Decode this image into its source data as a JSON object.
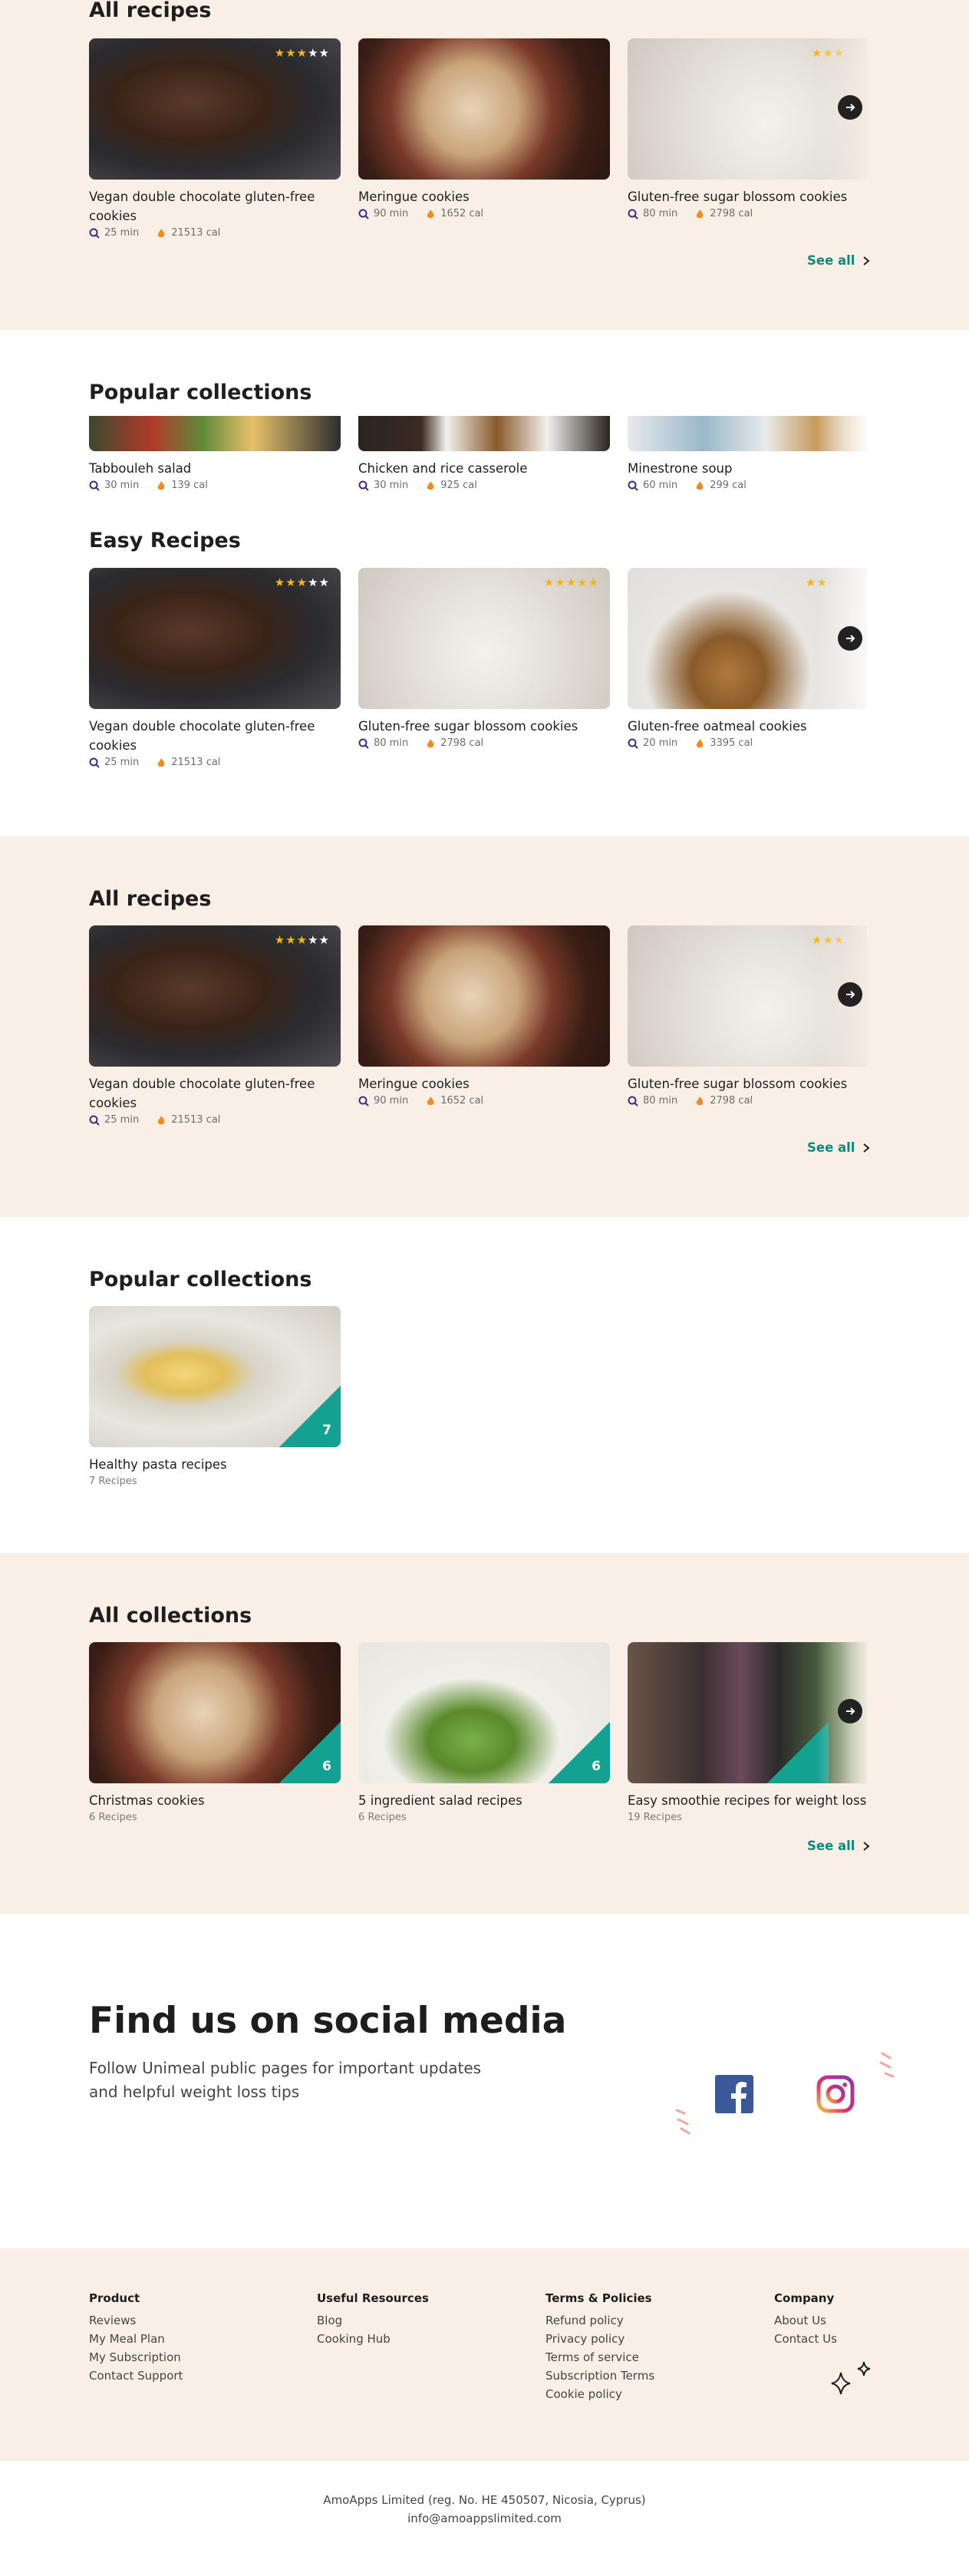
{
  "sec1": {
    "title": "All recipes",
    "cards": [
      {
        "title": "Vegan double chocolate gluten-free cookies",
        "time": "25 min",
        "cal": "21513 cal",
        "rating": 3
      },
      {
        "title": "Meringue cookies",
        "time": "90 min",
        "cal": "1652 cal"
      },
      {
        "title": "Gluten-free sugar blossom cookies",
        "time": "80 min",
        "cal": "2798 cal",
        "rating": 3
      }
    ],
    "see_all": "See all"
  },
  "sec2": {
    "title": "Popular collections",
    "cards": [
      {
        "title": "Tabbouleh salad",
        "time": "30 min",
        "cal": "139 cal"
      },
      {
        "title": "Chicken and rice casserole",
        "time": "30 min",
        "cal": "925 cal"
      },
      {
        "title": "Minestrone soup",
        "time": "60 min",
        "cal": "299 cal"
      }
    ]
  },
  "sec3": {
    "title": "Easy Recipes",
    "cards": [
      {
        "title": "Vegan double chocolate gluten-free cookies",
        "time": "25 min",
        "cal": "21513 cal",
        "rating": 3
      },
      {
        "title": "Gluten-free sugar blossom cookies",
        "time": "80 min",
        "cal": "2798 cal",
        "rating": 5
      },
      {
        "title": "Gluten-free oatmeal cookies",
        "time": "20 min",
        "cal": "3395 cal",
        "rating": 2
      }
    ]
  },
  "sec4": {
    "title": "All recipes",
    "cards": [
      {
        "title": "Vegan double chocolate gluten-free cookies",
        "time": "25 min",
        "cal": "21513 cal",
        "rating": 3
      },
      {
        "title": "Meringue cookies",
        "time": "90 min",
        "cal": "1652 cal"
      },
      {
        "title": "Gluten-free sugar blossom cookies",
        "time": "80 min",
        "cal": "2798 cal",
        "rating": 3
      }
    ],
    "see_all": "See all"
  },
  "sec5": {
    "title": "Popular collections",
    "cards": [
      {
        "title": "Healthy pasta recipes",
        "count": "7",
        "recipes": "7 Recipes"
      }
    ]
  },
  "sec6": {
    "title": "All collections",
    "cards": [
      {
        "title": "Christmas cookies",
        "count": "6",
        "recipes": "6 Recipes"
      },
      {
        "title": "5 ingredient salad recipes",
        "count": "6",
        "recipes": "6 Recipes"
      },
      {
        "title": "Easy smoothie recipes for weight loss",
        "count": "19",
        "recipes": "19 Recipes"
      }
    ],
    "see_all": "See all"
  },
  "social": {
    "title": "Find us on social media",
    "text_line1": "Follow Unimeal public pages for important updates",
    "text_line2": "and helpful weight loss tips"
  },
  "footer": {
    "columns": [
      {
        "heading": "Product",
        "links": [
          "Reviews",
          "My Meal Plan",
          "My Subscription",
          "Contact Support"
        ]
      },
      {
        "heading": "Useful Resources",
        "links": [
          "Blog",
          "Cooking Hub"
        ]
      },
      {
        "heading": "Terms & Policies",
        "links": [
          "Refund policy",
          "Privacy policy",
          "Terms of service",
          "Subscription Terms",
          "Cookie policy"
        ]
      },
      {
        "heading": "Company",
        "links": [
          "About Us",
          "Contact Us"
        ]
      }
    ],
    "legal_line1": "AmoApps Limited (reg. No. HE 450507, Nicosia, Cyprus)",
    "legal_line2": "info@amoappslimited.com"
  },
  "colors": {
    "accent": "#0c8a7d",
    "beige": "#f9efe6",
    "star": "#f2b51c",
    "badge": "#13a192"
  }
}
